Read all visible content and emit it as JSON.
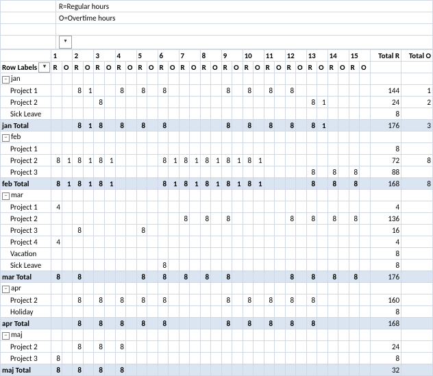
{
  "legend": {
    "r": "R=Regular hours",
    "o": "O=Overtime hours"
  },
  "header": {
    "row_labels": "Row Labels",
    "days": [
      1,
      2,
      3,
      4,
      5,
      6,
      7,
      8,
      9,
      10,
      11,
      12,
      13,
      14,
      15
    ],
    "sub": [
      "R",
      "O"
    ],
    "total_r": "Total R",
    "total_o": "Total O"
  },
  "rows": [
    {
      "type": "group",
      "label": "jan"
    },
    {
      "type": "item",
      "label": "Project 1",
      "cells": {
        "1": 8,
        "2": 1,
        "5": 8,
        "7": 8,
        "9": 8,
        "15": 8,
        "17": 8,
        "19": 8,
        "21": 8
      },
      "tr": 144,
      "to": 1
    },
    {
      "type": "item",
      "label": "Project 2",
      "cells": {
        "3": 8,
        "23": 8,
        "24": 1
      },
      "tr": 24,
      "to": 2
    },
    {
      "type": "item",
      "label": "Sick Leave",
      "cells": {},
      "tr": 8
    },
    {
      "type": "total",
      "label": "jan Total",
      "cells": {
        "1": 8,
        "2": 1,
        "3": 8,
        "5": 8,
        "7": 8,
        "9": 8,
        "15": 8,
        "17": 8,
        "19": 8,
        "21": 8,
        "23": 8,
        "24": 1
      },
      "tr": 176,
      "to": 3
    },
    {
      "type": "group",
      "label": "feb"
    },
    {
      "type": "item",
      "label": "Project 1",
      "cells": {},
      "tr": 8
    },
    {
      "type": "item",
      "label": "Project 2",
      "cells": {
        "-1": 8,
        "0": 1,
        "1": 8,
        "2": 1,
        "3": 8,
        "4": 1,
        "9": 8,
        "10": 1,
        "11": 8,
        "12": 1,
        "13": 8,
        "14": 1,
        "15": 8,
        "16": 1,
        "17": 8,
        "18": 1
      },
      "tr": 72,
      "to": 8
    },
    {
      "type": "item",
      "label": "Project 3",
      "cells": {
        "23": 8,
        "25": 8,
        "27": 8
      },
      "tr": 88
    },
    {
      "type": "total",
      "label": "feb Total",
      "cells": {
        "-1": 8,
        "0": 1,
        "1": 8,
        "2": 1,
        "3": 8,
        "4": 1,
        "9": 8,
        "10": 1,
        "11": 8,
        "12": 1,
        "13": 8,
        "14": 1,
        "15": 8,
        "16": 1,
        "17": 8,
        "18": 1,
        "23": 8,
        "25": 8,
        "27": 8
      },
      "tr": 168,
      "to": 8
    },
    {
      "type": "group",
      "label": "mar"
    },
    {
      "type": "item",
      "label": "Project 1",
      "cells": {
        "-1": 4
      },
      "tr": 4
    },
    {
      "type": "item",
      "label": "Project 2",
      "cells": {
        "11": 8,
        "13": 8,
        "15": 8,
        "21": 8,
        "23": 8,
        "25": 8,
        "27": 8
      },
      "tr": 136
    },
    {
      "type": "item",
      "label": "Project 3",
      "cells": {
        "1": 8,
        "7": 8
      },
      "tr": 16
    },
    {
      "type": "item",
      "label": "Project 4",
      "cells": {
        "-1": 4
      },
      "tr": 4
    },
    {
      "type": "item",
      "label": "Vacation",
      "cells": {},
      "tr": 8
    },
    {
      "type": "item",
      "label": "Sick Leave",
      "cells": {
        "9": 8
      },
      "tr": 8
    },
    {
      "type": "total",
      "label": "mar Total",
      "cells": {
        "-1": 8,
        "1": 8,
        "7": 8,
        "9": 8,
        "11": 8,
        "13": 8,
        "15": 8,
        "21": 8,
        "23": 8,
        "25": 8,
        "27": 8
      },
      "tr": 176
    },
    {
      "type": "group",
      "label": "apr"
    },
    {
      "type": "item",
      "label": "Project 2",
      "cells": {
        "1": 8,
        "3": 8,
        "5": 8,
        "7": 8,
        "9": 8,
        "15": 8,
        "17": 8,
        "19": 8,
        "21": 8,
        "23": 8
      },
      "tr": 160
    },
    {
      "type": "item",
      "label": "Holiday",
      "cells": {},
      "tr": 8
    },
    {
      "type": "total",
      "label": "apr Total",
      "cells": {
        "1": 8,
        "3": 8,
        "5": 8,
        "7": 8,
        "9": 8,
        "15": 8,
        "17": 8,
        "19": 8,
        "21": 8,
        "23": 8
      },
      "tr": 168
    },
    {
      "type": "group",
      "label": "maj"
    },
    {
      "type": "item",
      "label": "Project 2",
      "cells": {
        "1": 8,
        "3": 8,
        "5": 8
      },
      "tr": 24
    },
    {
      "type": "item",
      "label": "Project 3",
      "cells": {
        "-1": 8
      },
      "tr": 8
    },
    {
      "type": "total",
      "label": "maj Total",
      "cells": {
        "-1": 8,
        "1": 8,
        "3": 8,
        "5": 8
      },
      "tr": 32
    }
  ]
}
